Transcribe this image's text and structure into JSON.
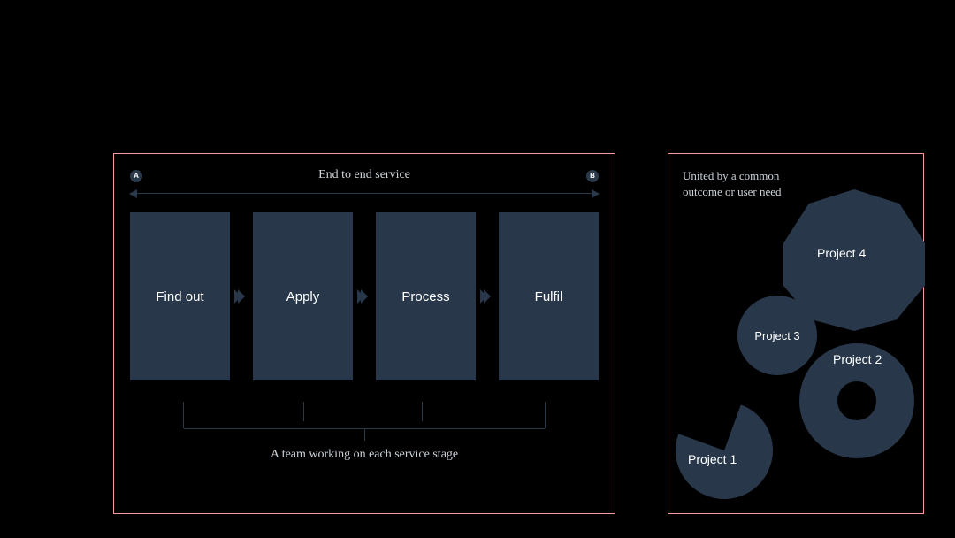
{
  "left": {
    "endcapA": "A",
    "endcapB": "B",
    "topLabel": "End to end service",
    "stages": [
      "Find out",
      "Apply",
      "Process",
      "Fulfil"
    ],
    "bottomLabel": "A team working on each service stage"
  },
  "right": {
    "caption": "United by a common outcome or user need",
    "projects": {
      "p1": "Project 1",
      "p2": "Project 2",
      "p3": "Project 3",
      "p4": "Project 4"
    }
  },
  "colors": {
    "panelBorder": "#f59b9b",
    "shapeFill": "#28384a",
    "ink": "#ccd3da"
  }
}
